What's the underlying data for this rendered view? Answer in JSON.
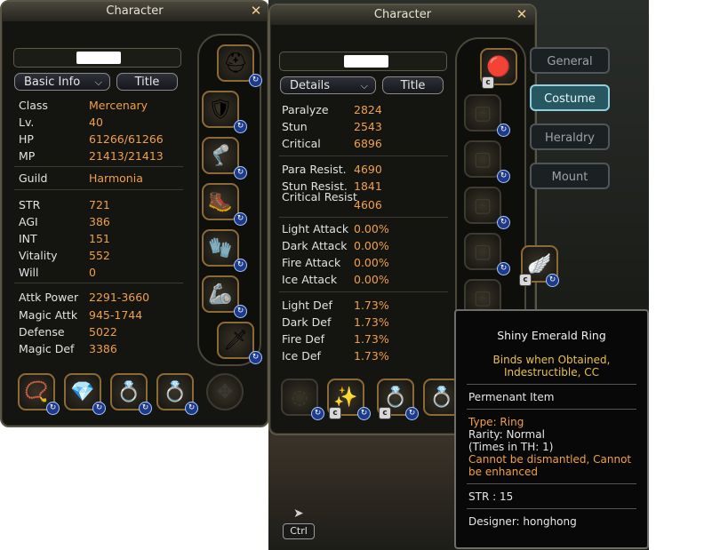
{
  "left_window": {
    "title": "Character",
    "view_select": "Basic Info",
    "title_button": "Title",
    "stats": [
      {
        "label": "Class",
        "value": "Mercenary"
      },
      {
        "label": "Lv.",
        "value": "40"
      },
      {
        "label": "HP",
        "value": "61266/61266"
      },
      {
        "label": "MP",
        "value": "21413/21413"
      },
      {
        "label": "Guild",
        "value": "Harmonia"
      },
      {
        "label": "STR",
        "value": "721"
      },
      {
        "label": "AGI",
        "value": "386"
      },
      {
        "label": "INT",
        "value": "151"
      },
      {
        "label": "Vitality",
        "value": "552"
      },
      {
        "label": "Will",
        "value": "0"
      },
      {
        "label": "Attk Power",
        "value": "2291-3660"
      },
      {
        "label": "Magic Attk",
        "value": "945-1744"
      },
      {
        "label": "Defense",
        "value": "5022"
      },
      {
        "label": "Magic Def",
        "value": "3386"
      }
    ]
  },
  "right_window": {
    "title": "Character",
    "view_select": "Details",
    "title_button": "Title",
    "stats": [
      {
        "label": "Paralyze",
        "value": "2824"
      },
      {
        "label": "Stun",
        "value": "2543"
      },
      {
        "label": "Critical",
        "value": "6896"
      },
      {
        "label": "Para Resist.",
        "value": "4690"
      },
      {
        "label": "Stun Resist.",
        "value": "1841"
      },
      {
        "label": "Critical Resist",
        "value": "4606"
      },
      {
        "label": "Light Attack",
        "value": "0.00%"
      },
      {
        "label": "Dark Attack",
        "value": "0.00%"
      },
      {
        "label": "Fire Attack",
        "value": "0.00%"
      },
      {
        "label": "Ice Attack",
        "value": "0.00%"
      },
      {
        "label": "Light Def",
        "value": "1.73%"
      },
      {
        "label": "Dark Def",
        "value": "1.73%"
      },
      {
        "label": "Fire Def",
        "value": "1.73%"
      },
      {
        "label": "Ice Def",
        "value": "1.73%"
      }
    ],
    "side_tabs": [
      "General",
      "Costume",
      "Heraldry",
      "Mount"
    ],
    "active_tab": "Costume",
    "ctrl_label": "Ctrl"
  },
  "tooltip": {
    "item_name": "Shiny Emerald Ring",
    "binding_line1": "Binds when Obtained,",
    "binding_line2": "Indestructible, CC",
    "duration": "Permenant Item",
    "type": "Type: Ring",
    "rarity": "Rarity: Normal",
    "times": "(Times in TH: 1)",
    "restriction_line1": "Cannot be dismantled, Cannot",
    "restriction_line2": "be enhanced",
    "stat": "STR : 15",
    "designer": "Designer: honghong"
  },
  "colors": {
    "value": "#f0a04a",
    "label": "#e2e2e2",
    "binding": "#e8c050",
    "warning": "#f0a04a"
  },
  "icons": {
    "close": "close-icon",
    "refresh": "refresh-badge-icon",
    "costume": "costume-c-badge-icon"
  }
}
